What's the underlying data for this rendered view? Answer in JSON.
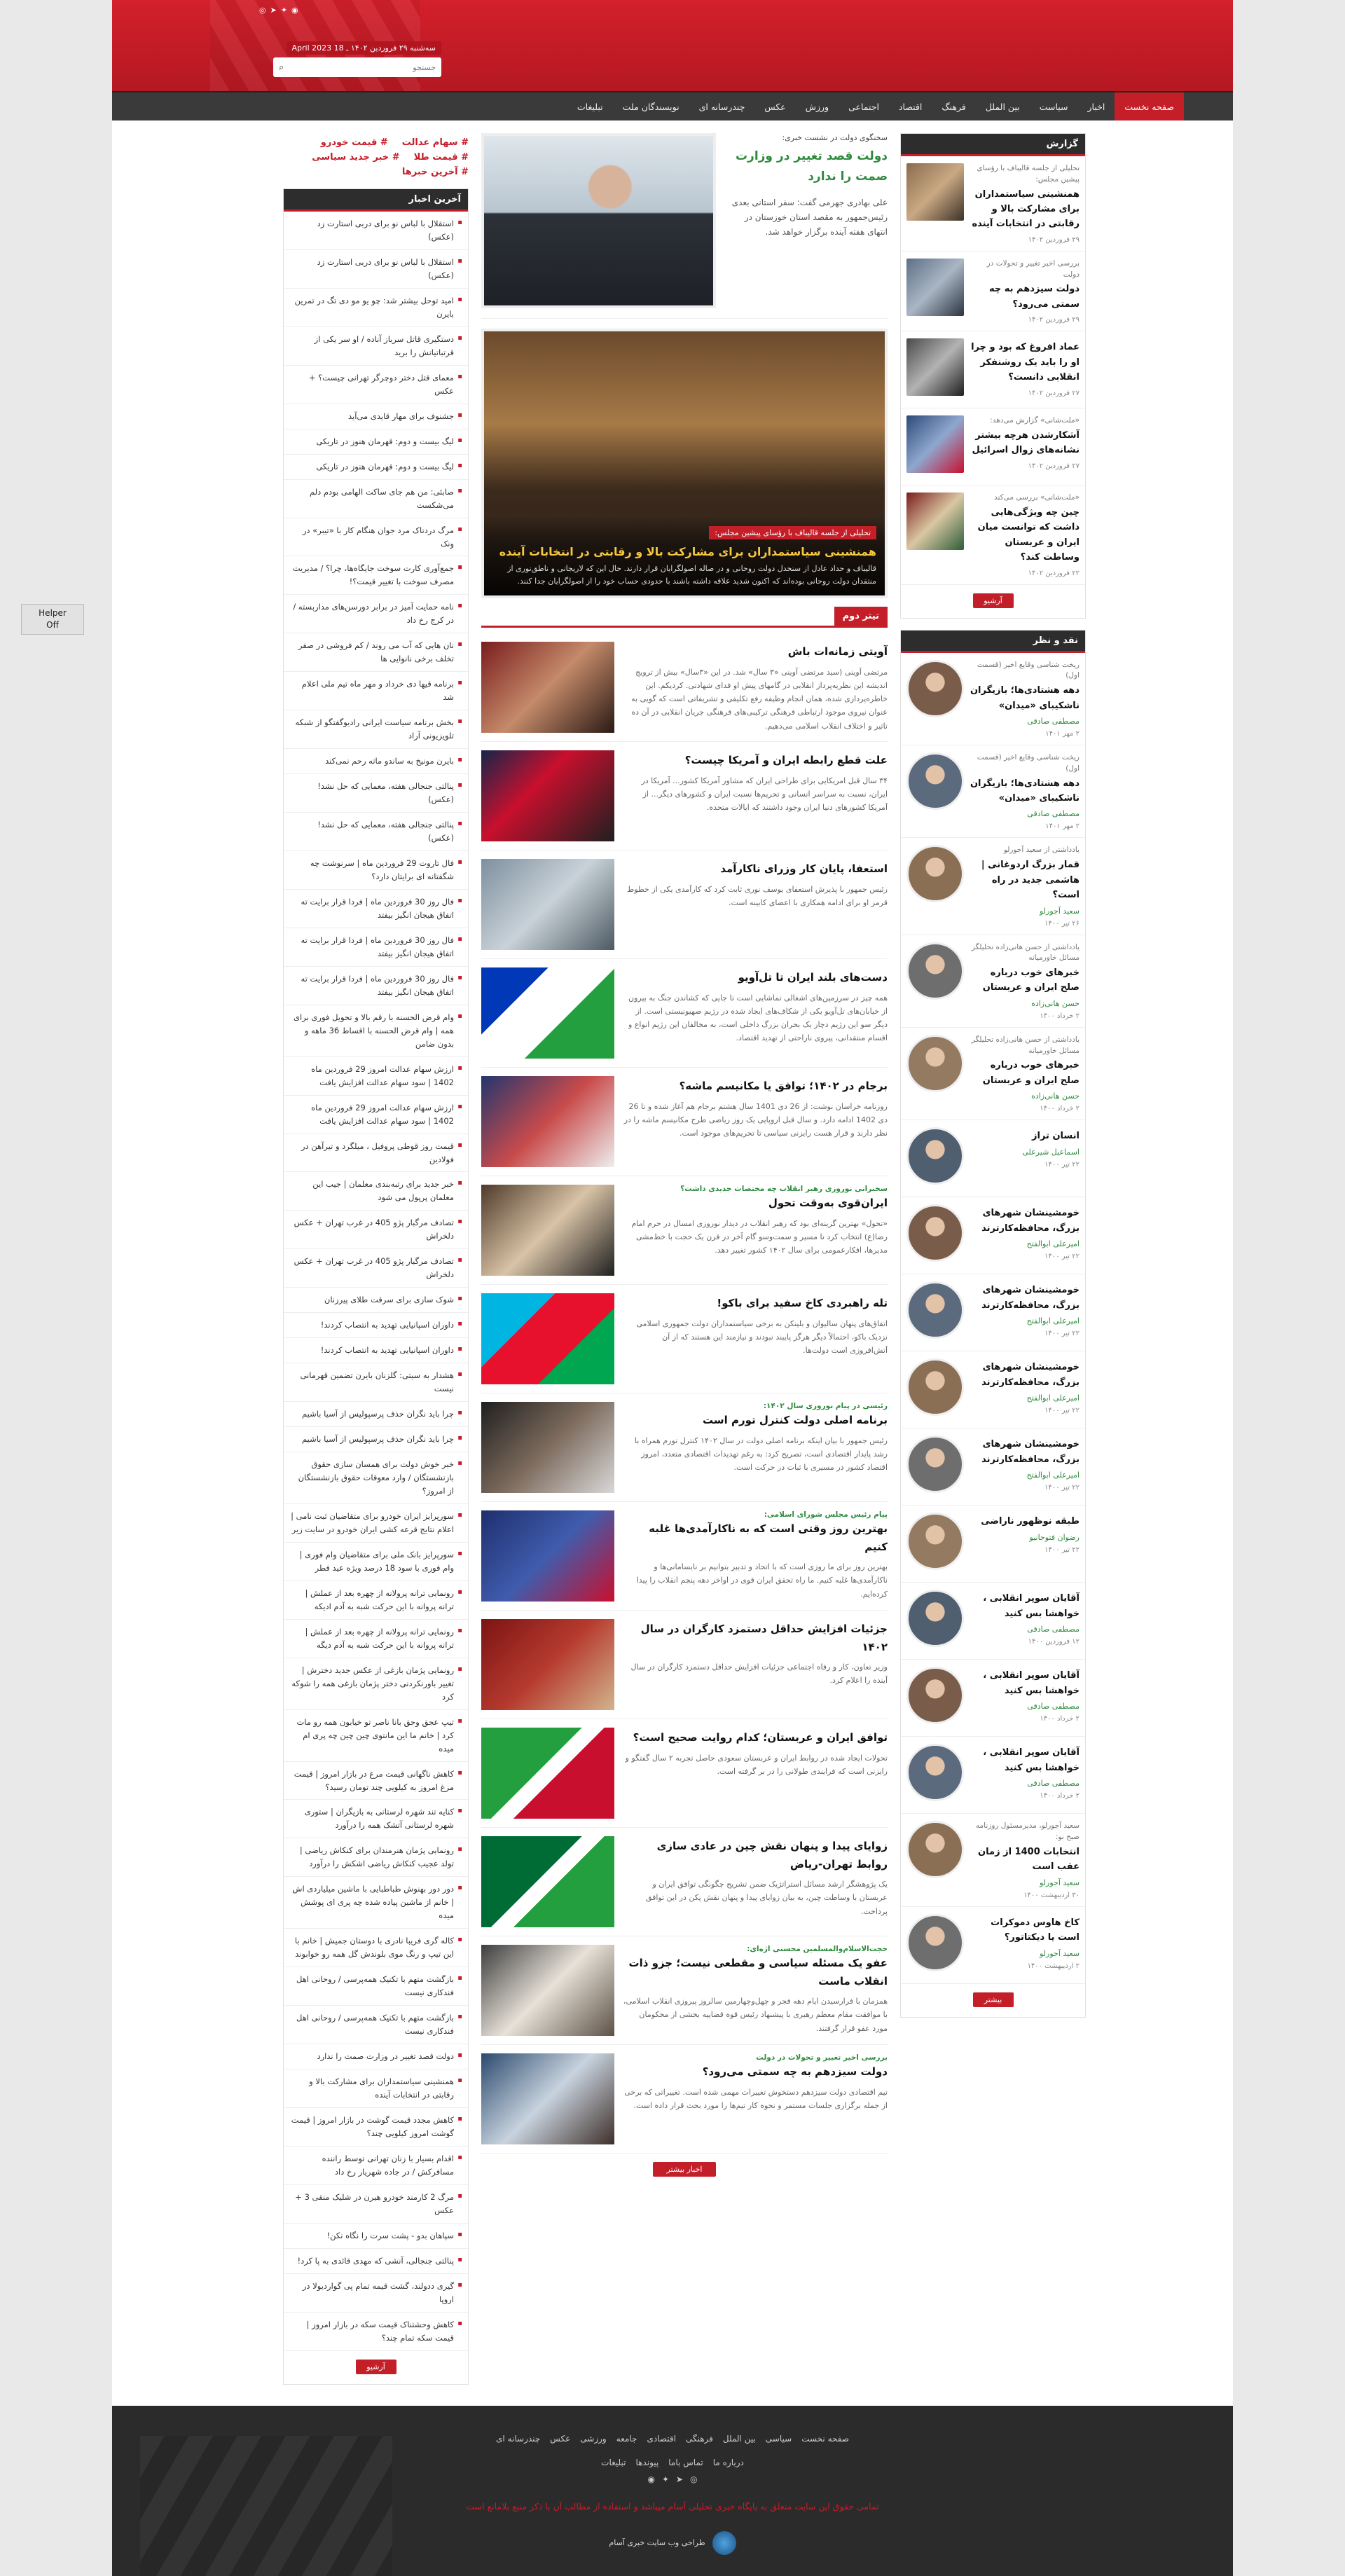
{
  "header": {
    "social": [
      "instagram",
      "telegram",
      "twitter",
      "rss"
    ],
    "date": "سه‌شنبه ۲۹ فروردین ۱۴۰۲ ـ 18 April 2023",
    "search_placeholder": "جستجو"
  },
  "nav": [
    "صفحه نخست",
    "اخبار",
    "سیاست",
    "بین الملل",
    "فرهنگ",
    "اقتصاد",
    "اجتماعی",
    "ورزش",
    "عکس",
    "چندرسانه ای",
    "نویسندگان ملت",
    "تبلیغات"
  ],
  "helper": {
    "line1": "Helper",
    "line2": "Off"
  },
  "reports": {
    "title": "گزارش",
    "items": [
      {
        "pre": "تحلیلی از جلسه قالیباف با رؤسای پیشین مجلس:",
        "title": "همنشینی سیاستمداران برای مشارکت بالا و رقابتی در انتخابات آینده",
        "date": "۲۹ فروردین ۱۴۰۲"
      },
      {
        "pre": "بررسی اخیر تغییر و تحولات در دولت",
        "title": "دولت سیزدهم به چه سمتی می‌رود؟",
        "date": "۲۹ فروردین ۱۴۰۲"
      },
      {
        "pre": "",
        "title": "عماد افروغ که بود و چرا او را باید یک روشنفکر انقلابی دانست؟",
        "date": "۲۷ فروردین ۱۴۰۲"
      },
      {
        "pre": "«ملت‌شانی» گزارش می‌دهد:",
        "title": "آشکارشدن هرچه بیشتر نشانه‌های زوال اسرائیل",
        "date": "۲۷ فروردین ۱۴۰۲"
      },
      {
        "pre": "«ملت‌شانی» بررسی می‌کند",
        "title": "چین چه ویژگی‌هایی داشت که توانست میان ایران و عربستان وساطت کند؟",
        "date": "۲۲ فروردین ۱۴۰۲"
      }
    ],
    "more": "آرشیو"
  },
  "critique": {
    "title": "نقد و نظر",
    "items": [
      {
        "pre": "ریخت شناسی وقایع اخیر (قسمت اول)",
        "title": "دهه هشتادی‌ها؛ بازیگران ناشکیبای «میدان»",
        "author": "مصطفی صادقی",
        "date": "۲ مهر ۱۴۰۱"
      },
      {
        "pre": "ریخت شناسی وقایع اخیر (قسمت اول)",
        "title": "دهه هشتادی‌ها؛ بازیگران ناشکیبای «میدان»",
        "author": "مصطفی صادقی",
        "date": "۲ مهر ۱۴۰۱"
      },
      {
        "pre": "یادداشتی از سعید آجورلو",
        "title": "قمار بزرگ اردوغانی | هاشمی جدید در راه است؟",
        "author": "سعید آجورلو",
        "date": "۲۶ تیر ۱۴۰۰"
      },
      {
        "pre": "یادداشتی از حسن هانی‌زاده تحلیلگر مسائل خاورمیانه",
        "title": "خبرهای خوب درباره صلح ایران و عربستان",
        "author": "حسن هانی‌زاده",
        "date": "۲ خرداد ۱۴۰۰"
      },
      {
        "pre": "یادداشتی از حسن هانی‌زاده تحلیلگر مسائل خاورمیانه",
        "title": "خبرهای خوب درباره صلح ایران و عربستان",
        "author": "حسن هانی‌زاده",
        "date": "۲ خرداد ۱۴۰۰"
      },
      {
        "pre": "",
        "title": "انسان تراز",
        "author": "اسماعیل شیرعلی",
        "date": "۲۲ تیر ۱۴۰۰"
      },
      {
        "pre": "",
        "title": "خومشینشان شهرهای بزرگ، محافظه‌کارترند",
        "author": "امیرعلی ابوالفتح",
        "date": "۲۲ تیر ۱۴۰۰"
      },
      {
        "pre": "",
        "title": "خومشینشان شهرهای بزرگ، محافظه‌کارترند",
        "author": "امیرعلی ابوالفتح",
        "date": "۲۲ تیر ۱۴۰۰"
      },
      {
        "pre": "",
        "title": "خومشینشان شهرهای بزرگ، محافظه‌کارترند",
        "author": "امیرعلی ابوالفتح",
        "date": "۲۲ تیر ۱۴۰۰"
      },
      {
        "pre": "",
        "title": "خومشینشان شهرهای بزرگ، محافظه‌کارترند",
        "author": "امیرعلی ابوالفتح",
        "date": "۲۲ تیر ۱۴۰۰"
      },
      {
        "pre": "",
        "title": "طبقه نوظهور ناراضی",
        "author": "رضوان فتوحانیو",
        "date": "۲۲ تیر ۱۴۰۰"
      },
      {
        "pre": "",
        "title": "آقایان سوپر انقلابی ، خواهشا بس کنید",
        "author": "مصطفی صادقی",
        "date": "۱۲ فروردین ۱۴۰۰"
      },
      {
        "pre": "",
        "title": "آقایان سوپر انقلابی ، خواهشا بس کنید",
        "author": "مصطفی صادقی",
        "date": "۲ خرداد ۱۴۰۰"
      },
      {
        "pre": "",
        "title": "آقایان سوپر انقلابی ، خواهشا بس کنید",
        "author": "مصطفی صادقی",
        "date": "۲ خرداد ۱۴۰۰"
      },
      {
        "pre": "سعید آجورلو، مدیرمسئول روزنامه صبح نو:",
        "title": "انتخابات 1400 از زمان عقب است",
        "author": "سعید آجورلو",
        "date": "۳۰ اردیبهشت ۱۴۰۰"
      },
      {
        "pre": "",
        "title": "کاخ هاوس دموکرات است یا دیکتاتور؟",
        "author": "سعید آجورلو",
        "date": "۲ اردیبهشت ۱۴۰۰"
      }
    ],
    "more": "بیشتر"
  },
  "top_story": {
    "pre": "سخنگوی دولت در نشست خبری:",
    "title": "دولت قصد تغییر در وزارت صمت را ندارد",
    "lead": "علی بهادری جهرمی گفت: سفر استانی بعدی رئیس‌جمهور به مقصد استان خوزستان در انتهای هفته آینده برگزار خواهد شد."
  },
  "feature": {
    "pre": "تحلیلی از جلسه قالیباف با رؤسای پیشین مجلس:",
    "title": "همنشینی سیاستمداران برای مشارکت بالا و رقابتی در انتخابات آینده",
    "lead": "قالیباف و حداد عادل از سنخدل دولت روحانی و در صاله اصولگرایان قرار دارند. حال این که لاریجانی و ناطق‌نوری از منتقدان دولت روحانی بوده‌اند که اکنون شدید علاقه داشته باشند با حدودی حساب خود را از اصولگرایان جدا کنند."
  },
  "section_title": "تیتر دوم",
  "news": [
    {
      "pre": "",
      "title": "آویتی زمانه‌ات باش",
      "lead": "مرتضی آوینی (سید مرتضی آوینی «۳ سال» شد. در این «۳سال» بیش از ترویج اندیشه این نظریه‌پرداز انقلابی در گامهای پیش او فدای شهادتی. کردیکم. این خاطره‌پردازی شده، همان انجام وظیفه رفع تکلیفی و تشریفاتی است که گویی به عنوان نیروی موجود ارتباطی فرهنگی ترکیبی‌های فرهنگی جریان انقلابی در آن ده تاثیر و اختلاف انقلاب اسلامی می‌دهیم."
    },
    {
      "pre": "",
      "title": "علت قطع رابطه ایران و آمریکا چیست؟",
      "lead": "۳۴ سال قبل امریکایی برای طراحی ایران که مشاور آمریکا کشور... آمریکا در ایران، نسبت به سراسر انسانی و تحریم‌ها نسبت ایران و کشورهای دیگر... از آمریکا کشورهای دنیا ایران وجود داشتند که ایالات متحده."
    },
    {
      "pre": "",
      "title": "استعفا، پایان کار وزرای ناکارآمد",
      "lead": "رئیس جمهور با پذیرش استعفای یوسف نوری ثابت کرد که کارآمدی یکی از خطوط قرمز او برای ادامه همکاری با اعضای کابینه است."
    },
    {
      "pre": "",
      "title": "دست‌های بلند ایران تا تل‌آویو",
      "lead": "همه چیز در سرزمین‌های اشغالی تماشایی است تا جایی که کشاندن جنگ به بیرون از خیابان‌های تل‌آویو یکی از شکاف‌های ایجاد شده در رژیم صهیونیستی است. از دیگر سو این رژیم دچار یک بحران بزرگ داخلی است، به مخالفان این رژیم انواع و اقسام منتقدانی، پیروی ناراحتی از تهدید اقتصاد."
    },
    {
      "pre": "",
      "title": "برجام در ۱۴۰۲؛ توافق یا مکانیسم ماشه؟",
      "lead": "روزنامه خراسان نوشت: از 26 دی 1401 سال هشتم برجام هم آغاز شده و تا 26 دی 1402 ادامه دارد. و سال قبل اروپایی یک روز ریاضی طرح مکانیسم ماشه را در نظر دارند و قرار هست رایزنی سیاسی تا تحریم‌های موجود است."
    },
    {
      "pre": "سخنرانی نوروزی رهبر انقلاب چه مختصات جدیدی داشت؟",
      "title": "ایران‌قوی به‌وقت تحول",
      "lead": "«تحول» بهترین گزینه‌ای بود که رهبر انقلاب در دیدار نوروزی امسال در حرم امام رضا(ع) انتخاب کرد تا مسیر و سمت‌وسو گام آخر در قرن یک حجت با خط‌مشی مدیرها، افکارعمومی برای سال ۱۴۰۲ کشور تغییر دهد."
    },
    {
      "pre": "",
      "title": "تله راهبردی کاخ سفید برای باکو!",
      "lead": "اتفاق‌های پنهان سالیوان و بلینکن به برخی سیاستمداران دولت جمهوری اسلامی نزدیک باکو، احتمالاً دیگر هرگز پایبند نبودند و نیازمند این هستند که از آن آتش‌افروزی است دولت‌ها."
    },
    {
      "pre": "رئیسی در پیام نوروزی سال ۱۴۰۲:",
      "title": "برنامه اصلی دولت کنترل تورم است",
      "lead": "رئیس جمهور با بیان اینکه برنامه اصلی دولت در سال ۱۴۰۲ کنترل تورم همراه با رشد پایدار اقتصادی است، تصریح کرد: به رغم تهدیدات اقتصادی متعدد، امروز اقتصاد کشور در مسیری با ثبات در حرکت است."
    },
    {
      "pre": "پیام رئیس مجلس شورای اسلامی:",
      "title": "بهترین روز وقتی است که به ناکارآمدی‌ها غلبه کنیم",
      "lead": "بهترین روز برای ما روزی است که با اتحاد و تدبیر بتوانیم بر نابسامانی‌ها و ناکارآمدی‌ها غلبه کنیم. ما راه تحقق ایران قوی در اواخر دهه پنجم انقلاب را پیدا کرده‌ایم."
    },
    {
      "pre": "",
      "title": "جزئیات افزایش حداقل دستمزد کارگران در سال ۱۴۰۲",
      "lead": "وزیر تعاون، کار و رفاه اجتماعی جزئیات افزایش حداقل دستمزد کارگران در سال آینده را اعلام کرد."
    },
    {
      "pre": "",
      "title": "توافق ایران و عربستان؛ کدام روایت صحیح است؟",
      "lead": "تحولات ایجاد شده در روابط ایران و عربستان سعودی حاصل تجربه ۲ سال گفتگو و رایزنی است که فرایندی طولانی را در بر گرفته است."
    },
    {
      "pre": "",
      "title": "زوایای پیدا و پنهان نقش چین در عادی سازی روابط تهران-ریاض",
      "lead": "یک پژوهشگر ارشد مسائل استراتژیک ضمن تشریح چگونگی توافق ایران و عربستان با وساطت چین، به بیان زوایای پیدا و پنهان نقش پکن در این توافق پرداخت."
    },
    {
      "pre": "حجت‌الاسلام‌والمسلمین محسنی اژه‌ای:",
      "title": "عفو یک مسئله سیاسی و مقطعی نیست؛ جزو ذات انقلاب ماست",
      "lead": "همزمان با فرارسیدن ایام دهه فجر و چهل‌وچهارمین سالروز پیروزی انقلاب اسلامی، با موافقت مقام معظم رهبری با پیشنهاد رئیس قوه قضاییه بخشی از محکومان مورد عفو قرار گرفتند."
    },
    {
      "pre": "بررسی اخیر تغییر و تحولات در دولت",
      "title": "دولت سیزدهم به چه سمتی می‌رود؟",
      "lead": "تیم اقتصادی دولت سیزدهم دستخوش تغییرات مهمی شده است. تغییراتی که برخی از جمله برگزاری جلسات مستمر و نحوه کار تیم‌ها را مورد بحث قرار داده است."
    }
  ],
  "news_more": "اخبار بیشتر",
  "tags": [
    "سهام عدالت",
    "قیمت خودرو",
    "قیمت طلا",
    "خبر جدید سیاسی",
    "آخرین خبرها"
  ],
  "latest": {
    "title": "آخرین اخبار",
    "items": [
      "استقلال با لباس نو برای دربی استارت زد (عکس)",
      "استقلال با لباس نو برای دربی استارت زد (عکس)",
      "امید توحل بیشتر شد: چو یو مو دی تگ در تمرین بایرن",
      "دستگیری قاتل سرباز آناده / او سر یکی از قرتباتیانش را برید",
      "معمای قتل دختر دوچرگر تهرانی چیست؟ + عکس",
      "جشنوف برای مهار قایدی می‌آید",
      "لیگ بیست و دوم: قهرمان هنوز در تاریکی",
      "لیگ بیست و دوم: قهرمان هنوز در تاریکی",
      "صابئی: من هم جای ساکت الهامی بودم دلم می‌شکست",
      "مرگ دردناک مرد جوان هنگام کار با «تیبر» در ونک",
      "جمع‌آوری کارت سوخت جایگاه‌ها، چرا؟ / مدیریت مصرف سوخت با تغییر قیمت؟!",
      "نامه حمایت آمیز در برابر دورسن‌های مداربسته / در کرج رخ داد",
      "نان هایی که آب می روند / کم فروشی در صفر تخلف برخی نانوایی ها",
      "برنامه قیها دی خرداد و مهر ماه تیم ملی اعلام شد",
      "بخش برنامه سیاست ایرانی رادیوگفتگو از شبکه تلویزیونی آراد",
      "بایرن مونیخ به ساندو ماته رحم نمی‌کند",
      "پنالتی جنجالی هفته، معمایی که حل نشد! (عکس)",
      "پنالتی جنجالی هفته، معمایی که حل نشد! (عکس)",
      "فال تاروت 29 فروردین ماه | سرنوشت چه شگفتانه ای برایتان دارد؟",
      "فال روز 30 فروردین ماه | فردا قرار برایت ته اتفاق هیجان انگیز بیفتد",
      "فال روز 30 فروردین ماه | فردا قرار برایت ته اتفاق هیجان انگیز بیفتد",
      "فال روز 30 فروردین ماه | فردا قرار برایت ته اتفاق هیجان انگیز بیفتد",
      "وام قرض الحسنه با رقم بالا و تحویل فوری برای همه | وام قرض الحسنه با اقساط 36 ماهه و بدون ضامن",
      "ارزش سهام عدالت امروز 29 فروردین ماه 1402 | سود سهام عدالت افزایش یافت",
      "ارزش سهام عدالت امروز 29 فروردین ماه 1402 | سود سهام عدالت افزایش یافت",
      "قیمت روز قوطی پروفیل ، میلگرد و تیرآهن در فولادین",
      "خبر جدید برای رتبه‌بندی معلمان | جیب این معلمان پرپول می شود",
      "تصادف مرگبار پژو 405 در غرب تهران + عکس دلخراش",
      "تصادف مرگبار پژو 405 در غرب تهران + عکس دلخراش",
      "شوک سازی برای سرقت طلای پیرزنان",
      "داوران اسپانیایی تهدید به انتصاب کردند!",
      "داوران اسپانیایی تهدید به انتصاب کردند!",
      "هشدار به سیتی: گلزنان بایرن تضمین قهرمانی نیست",
      "چرا باید نگران حذف پرسپولیس از آسیا باشیم",
      "چرا باید نگران حذف پرسپولیس از آسیا باشیم",
      "خبر خوش دولت برای همسان سازی حقوق بازنشستگان / وارد معوقات حقوق بازنشستگان از امروز؟",
      "سورپرایز ایران خودرو برای متقاضیان ثبت نامی | اعلام نتایج قرعه کشی ایران خودرو در سایت زیر",
      "سورپرایز بانک ملی برای متقاضیان وام فوری | وام فوری با سود 18 درصد ویژه عید فطر",
      "رونمایی ترانه پرولانه از چهره بعد از عملش | ترانه پروانه با این حرکت شبه به آدم ادیکه",
      "رونمایی ترانه پرولانه از چهره بعد از عملش | ترانه پروانه با این حرکت شبه به آدم دیگه",
      "رونمایی پژمان بازغی از عکس جدید دخترش | تغییر باورنکردنی دختر پژمان بازغی همه را شوکه کرد",
      "تیپ عجق وجق بانا ناصر تو خیابون همه رو مات کرد | خانم ما این مانتوی چین چین چه پری ام میده",
      "کاهش ناگهانی قیمت مرغ در بازار امروز | قیمت مرغ امروز به کیلویی چند تومان رسید؟",
      "کنایه تند شهره لرستانی به بازیگران | ستوری شهره لرستانی آتشک همه را درآورد",
      "رونمایی پژمان هنرمندان برای کنکاش ریاضی | تولد عجیب کنکاش ریاضی اشکش را درآورد",
      "دور دور بهنوش طباطبایی با ماشین میلیاردی اش | خانم از ماشین پیاده شده چه پری ای پوشش میده",
      "کاله گری فریبا نادری با دوستان جمیش | خانم با این تیپ و رنگ موی بلوندش گل همه رو خوابوند",
      "بازگشت متهم با تکنیک همه‌پرسی / روحانی اهل فندکاری نیست",
      "بازگشت متهم با تکنیک همه‌پرسی / روحانی اهل فندکاری نیست",
      "دولت قصد تغییر در وزارت صمت را ندارد",
      "همنشینی سیاستمداران برای مشارکت بالا و رقابتی در انتخابات آینده",
      "کاهش مجدد قیمت گوشت در بازار امروز | قیمت گوشت امروز کیلویی چند؟",
      "اقدام بسیار با زنان تهرانی توسط راننده مسافرکش / در جاده شهریار رخ داد",
      "مرگ 2 کارمند خودرو هیرن در شلیک منقی 3 + عکس",
      "سپاهان بدو - پشت سرت را نگاه نکن!",
      "پنالتی جنجالی، آنشی که مهدی قائدی به پا کرد!",
      "گیری ددولند، گشت قیمه تمام پی گواردیولا در اروپا",
      "کاهش وحشتناک قیمت سکه در بازار امروز | قیمت سکه تمام چند؟"
    ],
    "more": "آرشیو"
  },
  "footer": {
    "nav": [
      "صفحه نخست",
      "سیاسی",
      "بین الملل",
      "فرهنگی",
      "اقتصادی",
      "جامعه",
      "ورزشی",
      "عکس",
      "چندرسانه ای"
    ],
    "nav2": [
      "درباره ما",
      "تماس باما",
      "پیوندها",
      "تبلیغات"
    ],
    "copyright": "تمامی حقوق این سایت متعلق به پایگاه خبری تحلیلی آسام میباشد و استفاده از مطالب آن با ذکر منبع بلامانع است",
    "credit": "طراحی وب سایت خبری آسام"
  },
  "colors": {
    "brand": "#c41e29",
    "green": "#2e8b3e",
    "nav": "#3a3a3a"
  }
}
